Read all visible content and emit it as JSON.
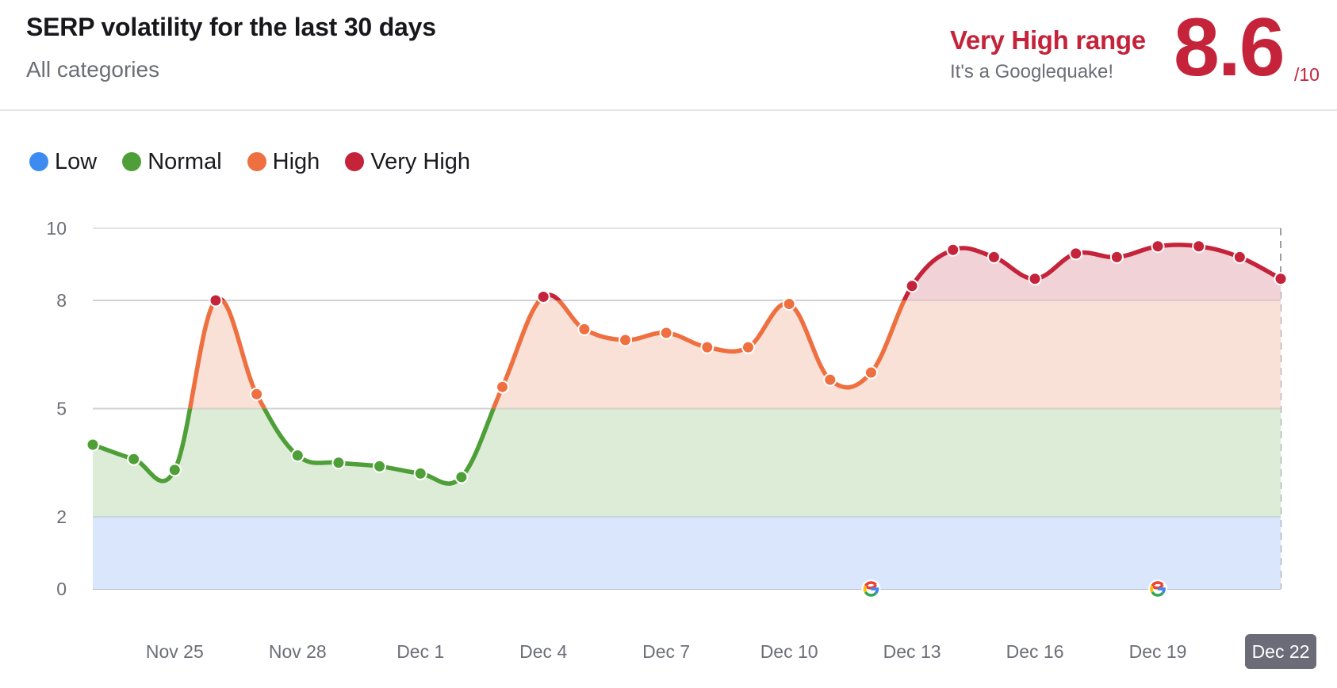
{
  "header": {
    "title": "SERP volatility for the last 30 days",
    "subtitle": "All categories",
    "range_label": "Very High range",
    "range_description": "It's a Googlequake!",
    "score": "8.6",
    "score_max": "/10"
  },
  "colors": {
    "low": "#3d8bf0",
    "normal": "#4e9f38",
    "high": "#ee7040",
    "very_high": "#c4233a",
    "low_fill": "#d9e6fb",
    "normal_fill": "#dcecd6",
    "high_fill": "#fae1d8",
    "very_high_fill": "#f1d2d7"
  },
  "legend": [
    {
      "key": "low",
      "label": "Low"
    },
    {
      "key": "normal",
      "label": "Normal"
    },
    {
      "key": "high",
      "label": "High"
    },
    {
      "key": "very_high",
      "label": "Very High"
    }
  ],
  "chart_data": {
    "type": "area",
    "title": "SERP volatility for the last 30 days",
    "xlabel": "",
    "ylabel": "",
    "ylim": [
      0,
      10
    ],
    "yticks": [
      "0",
      "2",
      "5",
      "8",
      "10"
    ],
    "ytick_values": [
      0,
      2,
      5,
      8,
      10
    ],
    "bands": [
      {
        "name": "Low",
        "from": 0,
        "to": 2
      },
      {
        "name": "Normal",
        "from": 2,
        "to": 5
      },
      {
        "name": "High",
        "from": 5,
        "to": 8
      },
      {
        "name": "Very High",
        "from": 8,
        "to": 10
      }
    ],
    "x": [
      "Nov 23",
      "Nov 24",
      "Nov 25",
      "Nov 26",
      "Nov 27",
      "Nov 28",
      "Nov 29",
      "Nov 30",
      "Dec 1",
      "Dec 2",
      "Dec 3",
      "Dec 4",
      "Dec 5",
      "Dec 6",
      "Dec 7",
      "Dec 8",
      "Dec 9",
      "Dec 10",
      "Dec 11",
      "Dec 12",
      "Dec 13",
      "Dec 14",
      "Dec 15",
      "Dec 16",
      "Dec 17",
      "Dec 18",
      "Dec 19",
      "Dec 20",
      "Dec 21",
      "Dec 22"
    ],
    "xtick_labels": [
      "Nov 25",
      "Nov 28",
      "Dec 1",
      "Dec 4",
      "Dec 7",
      "Dec 10",
      "Dec 13",
      "Dec 16",
      "Dec 19",
      "Dec 22"
    ],
    "series": [
      {
        "name": "Volatility",
        "values": [
          4.0,
          3.6,
          3.3,
          8.0,
          5.4,
          3.7,
          3.5,
          3.4,
          3.2,
          3.1,
          5.6,
          8.1,
          7.2,
          6.9,
          7.1,
          6.7,
          6.7,
          7.9,
          5.8,
          6.0,
          8.4,
          9.4,
          9.2,
          8.6,
          9.3,
          9.2,
          9.5,
          9.5,
          9.2,
          8.6
        ]
      }
    ],
    "google_updates": [
      "Dec 12",
      "Dec 19"
    ],
    "highlighted_x": "Dec 22",
    "grid": true
  }
}
